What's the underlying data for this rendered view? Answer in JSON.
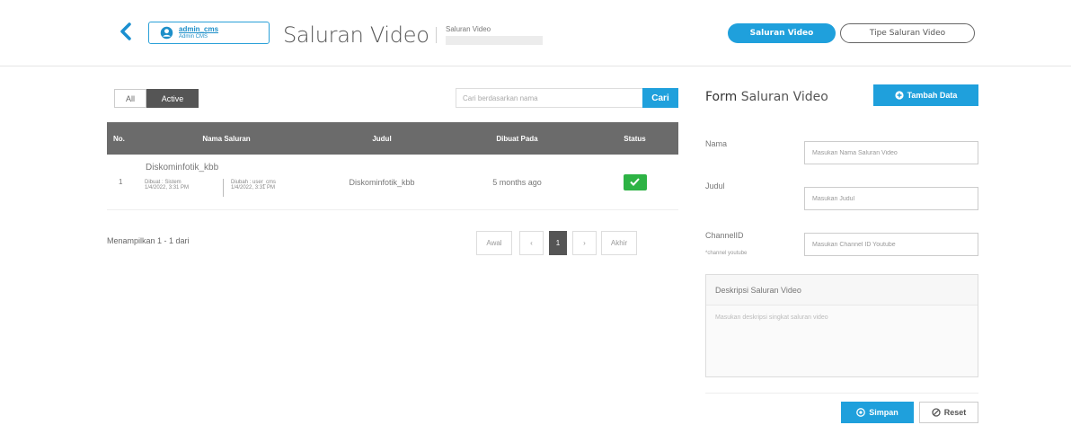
{
  "header": {
    "back_icon": "chevron-left-icon",
    "user": {
      "name": "admin_cms",
      "role": "Admin CMS",
      "icon": "user-circle-icon"
    },
    "title": "Saluran Video",
    "breadcrumb": "Saluran Video",
    "nav": [
      {
        "label": "Saluran Video",
        "active": true
      },
      {
        "label": "Tipe Saluran Video",
        "active": false
      }
    ]
  },
  "filters": {
    "all_label": "All",
    "active_label": "Active"
  },
  "search": {
    "placeholder": "Cari berdasarkan nama",
    "button_label": "Cari"
  },
  "table": {
    "columns": [
      "No.",
      "Nama Saluran",
      "Judul",
      "Dibuat Pada",
      "Status"
    ],
    "rows": [
      {
        "no": "1",
        "nama": "Diskominfotik_kbb",
        "dibuat_line1": "Dibuat : Sistem",
        "dibuat_line2": "1/4/2022, 3:31 PM",
        "diubah_line1": "Diubah : user_cms",
        "diubah_line2": "1/4/2022, 3:31 PM",
        "judul": "Diskominfotik_kbb",
        "dibuat_pada": "5 months ago",
        "status": "active"
      }
    ]
  },
  "showing_text": "Menampilkan 1 - 1 dari",
  "pagination": {
    "first": "Awal",
    "prev": "‹",
    "current": "1",
    "next": "›",
    "last": "Akhir"
  },
  "form": {
    "title_bold": "Form",
    "title_rest": " Saluran Video",
    "add_button": "Tambah Data",
    "fields": {
      "nama_label": "Nama",
      "nama_placeholder": "Masukan Nama Saluran Video",
      "judul_label": "Judul",
      "judul_placeholder": "Masukan Judul",
      "channel_label": "ChannelID",
      "channel_sub": "*channel youtube",
      "channel_placeholder": "Masukan Channel ID Youtube",
      "desc_label": "Deskripsi Saluran Video",
      "desc_placeholder": "Masukan deskripsi singkat saluran video"
    },
    "save_button": "Simpan",
    "reset_button": "Reset"
  },
  "colors": {
    "accent": "#1fa0dc",
    "status_ok": "#2db344",
    "table_header": "#6b6b6b"
  }
}
